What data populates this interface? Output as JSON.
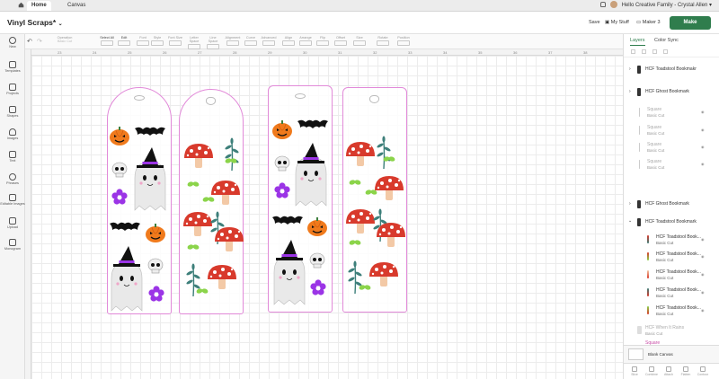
{
  "tabs": {
    "home": "Home",
    "canvas": "Canvas"
  },
  "user": {
    "greeting": "Hello Creative Family - Crystal Allen"
  },
  "header": {
    "project_title": "Vinyl Scraps*",
    "save_label": "Save",
    "mystuff_label": "My Stuff",
    "machine_label": "Maker 3",
    "make_label": "Make"
  },
  "toolbar": {
    "operation": "Operation",
    "operation_value": "Basic Cut",
    "select_all": "Select All",
    "edit": "Edit",
    "font": "Font",
    "style": "Style",
    "font_size": "Font Size",
    "letter_space": "Letter Space",
    "line_space": "Line Space",
    "alignment": "Alignment",
    "curve": "Curve",
    "advanced": "Advanced",
    "align": "Align",
    "arrange": "Arrange",
    "flip": "Flip",
    "offset": "Offset",
    "size": "Size",
    "rotate": "Rotate",
    "position": "Position"
  },
  "rail": [
    {
      "label": "New",
      "icon": "plus-icon"
    },
    {
      "label": "Templates",
      "icon": "shirt-icon"
    },
    {
      "label": "Projects",
      "icon": "grid-icon"
    },
    {
      "label": "Shapes",
      "icon": "shapes-icon"
    },
    {
      "label": "Images",
      "icon": "bulb-icon"
    },
    {
      "label": "Text",
      "icon": "text-icon"
    },
    {
      "label": "Phrases",
      "icon": "speech-icon"
    },
    {
      "label": "Editable Images",
      "icon": "editable-image-icon"
    },
    {
      "label": "Upload",
      "icon": "upload-icon"
    },
    {
      "label": "Monogram",
      "icon": "monogram-icon"
    }
  ],
  "ruler": [
    "23",
    "24",
    "25",
    "26",
    "27",
    "28",
    "29",
    "30",
    "31",
    "32",
    "33",
    "34",
    "35",
    "36",
    "37",
    "38"
  ],
  "panel": {
    "tab_layers": "Layers",
    "tab_colorsync": "Color Sync",
    "layers": [
      {
        "name": "HCF Toadstool Bookmakr",
        "sub": ""
      },
      {
        "name": "HCF Ghost Bookmark",
        "sub": ""
      },
      {
        "name": "Square",
        "sub": "Basic Cut"
      },
      {
        "name": "Square",
        "sub": "Basic Cut"
      },
      {
        "name": "Square",
        "sub": "Basic Cut"
      },
      {
        "name": "Square",
        "sub": "Basic Cut"
      },
      {
        "name": "HCF Ghost Bookmark",
        "sub": ""
      },
      {
        "name": "HCF Toadstool Bookmark",
        "sub": ""
      },
      {
        "name": "HCF Toadstool Book...",
        "sub": "Basic Cut"
      },
      {
        "name": "HCF Toadstool Book...",
        "sub": "Basic Cut"
      },
      {
        "name": "HCF Toadstool Book...",
        "sub": "Basic Cut"
      },
      {
        "name": "HCF Toadstool Book...",
        "sub": "Basic Cut"
      },
      {
        "name": "HCF Toadstool Book...",
        "sub": "Basic Cut"
      },
      {
        "name": "HCF When It Rains",
        "sub": "Basic Cut"
      },
      {
        "name": "Square",
        "sub": ""
      }
    ],
    "blank_canvas": "Blank Canvas",
    "actions": [
      "Slice",
      "Combine",
      "Attach",
      "Flatten",
      "Contour"
    ]
  },
  "colors": {
    "accent": "#2f7d4d",
    "bookmark_outline": "#e28ad9",
    "mushroom_red": "#d83a2c",
    "pumpkin": "#f07a1c",
    "purple": "#9b34e6",
    "leaf_teal": "#3d7f7a",
    "lime": "#8bd44a"
  }
}
